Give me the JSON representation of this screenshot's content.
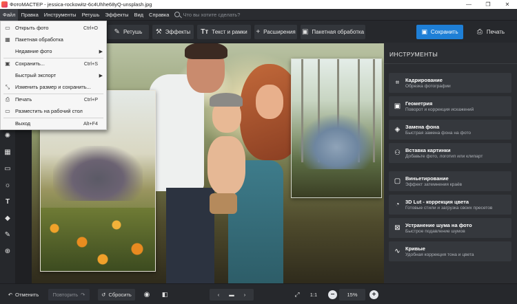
{
  "window": {
    "title": "ФотоМАСТЕР - jessica-rockowitz-6c4Uhhe68yQ-unsplash.jpg",
    "controls": {
      "minimize": "—",
      "maximize": "❐",
      "close": "✕"
    }
  },
  "menubar": {
    "items": [
      "Файл",
      "Правка",
      "Инструменты",
      "Ретушь",
      "Эффекты",
      "Вид",
      "Справка"
    ],
    "search_placeholder": "Что вы хотите сделать?"
  },
  "toolbar": {
    "retouch": "Ретушь",
    "effects": "Эффекты",
    "text_frames": "Текст и рамки",
    "extensions": "Расширения",
    "batch": "Пакетная обработка",
    "save": "Сохранить",
    "print": "Печать"
  },
  "file_menu": {
    "items": [
      {
        "label": "Открыть фото",
        "shortcut": "Ctrl+O",
        "icon": "folder-icon"
      },
      {
        "label": "Пакетная обработка",
        "shortcut": "",
        "icon": "batch-icon"
      },
      {
        "label": "Недавние фото",
        "shortcut": "",
        "icon": "",
        "submenu": true
      },
      {
        "label": "Сохранить...",
        "shortcut": "Ctrl+S",
        "icon": "save-icon"
      },
      {
        "label": "Быстрый экспорт",
        "shortcut": "",
        "icon": "",
        "submenu": true
      },
      {
        "label": "Изменить размер и сохранить...",
        "shortcut": "",
        "icon": "resize-icon"
      },
      {
        "label": "Печать",
        "shortcut": "Ctrl+P",
        "icon": "print-icon"
      },
      {
        "label": "Разместить на рабочий стол",
        "shortcut": "",
        "icon": "desktop-icon"
      },
      {
        "label": "Выход",
        "shortcut": "Alt+F4",
        "icon": ""
      }
    ]
  },
  "right_panel": {
    "title": "ИНСТРУМЕНТЫ",
    "cards": [
      {
        "title": "Кадрирование",
        "subtitle": "Обрезка фотографии",
        "icon": "crop-icon"
      },
      {
        "title": "Геометрия",
        "subtitle": "Поворот и коррекция искажений",
        "icon": "geometry-icon"
      },
      {
        "title": "Замена фона",
        "subtitle": "Быстрая замена фона на фото",
        "icon": "bucket-icon"
      },
      {
        "title": "Вставка картинки",
        "subtitle": "Добавьте фото, логотип или клипарт",
        "icon": "insert-image-icon"
      },
      {
        "title": "Виньетирование",
        "subtitle": "Эффект затемнения краёв",
        "icon": "vignette-icon"
      },
      {
        "title": "3D Lut - коррекция цвета",
        "subtitle": "Готовые стили и загрузка своих пресетов",
        "icon": "lut-icon"
      },
      {
        "title": "Устранение шума на фото",
        "subtitle": "Быстрое подавление шумов",
        "icon": "denoise-icon"
      },
      {
        "title": "Кривые",
        "subtitle": "Удобная коррекция тона и цвета",
        "icon": "curves-icon"
      }
    ]
  },
  "bottombar": {
    "undo": "Отменить",
    "redo": "Повторить",
    "reset": "Сбросить",
    "ratio": "1:1",
    "zoom": "15%"
  },
  "colors": {
    "accent": "#1e7fd6",
    "background": "#26282c",
    "panel": "#2b2d31",
    "card": "#35383d"
  }
}
